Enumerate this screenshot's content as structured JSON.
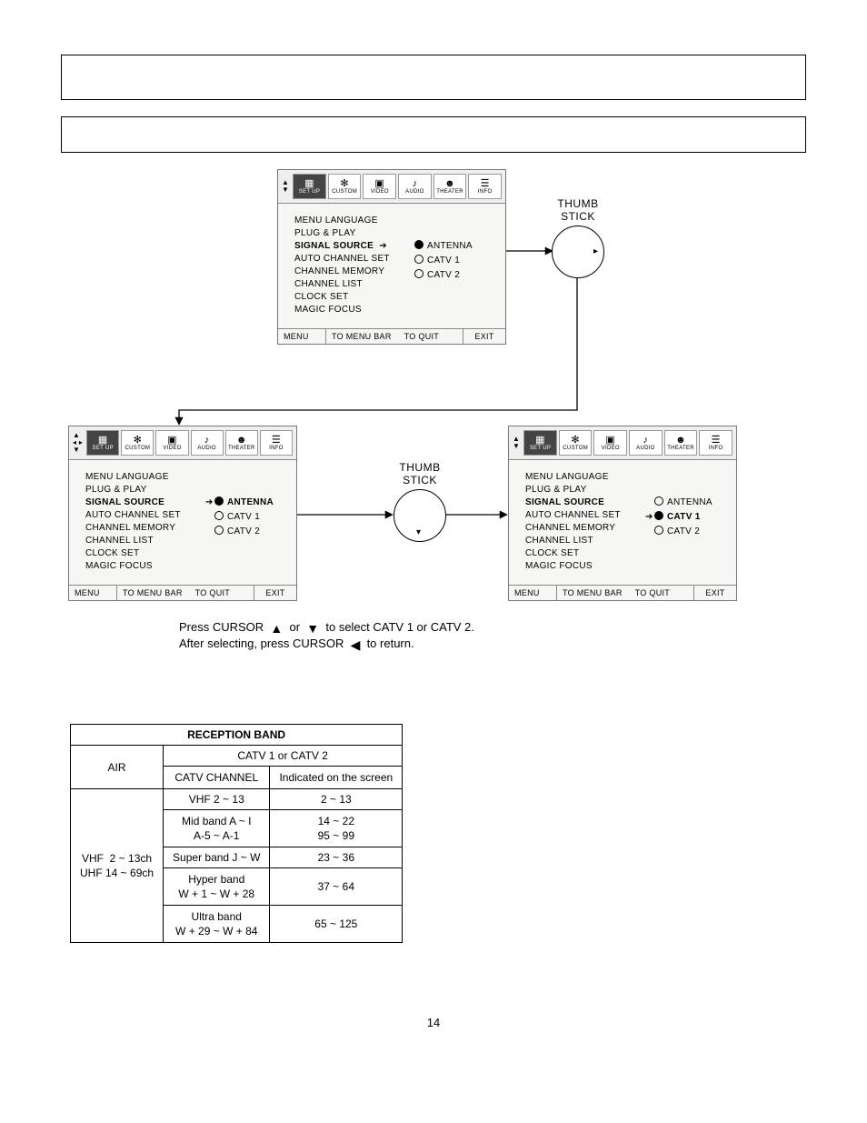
{
  "thumbstick_label": "THUMB\nSTICK",
  "osd": {
    "tabs": [
      "SET UP",
      "CUSTOM",
      "VIDEO",
      "AUDIO",
      "THEATER",
      "INFO"
    ],
    "items": [
      "MENU LANGUAGE",
      "PLUG & PLAY",
      "SIGNAL SOURCE",
      "AUTO CHANNEL SET",
      "CHANNEL MEMORY",
      "CHANNEL LIST",
      "CLOCK SET",
      "MAGIC FOCUS"
    ],
    "options": [
      "ANTENNA",
      "CATV 1",
      "CATV 2"
    ],
    "footer": {
      "menu": "MENU",
      "tobar": "TO MENU BAR",
      "quit": "TO QUIT",
      "exit": "EXIT"
    }
  },
  "legend": {
    "line1_pre": "Press CURSOR  ",
    "line1_mid": "  or  ",
    "line1_post": "  to select CATV 1 or CATV 2.",
    "line2_pre": "After selecting, press CURSOR  ",
    "line2_post": "  to return."
  },
  "table": {
    "title": "RECEPTION BAND",
    "air": "AIR",
    "catv_header": "CATV 1 or CATV 2",
    "ch_header": "CATV CHANNEL",
    "ind_header": "Indicated on the screen",
    "air_rows": "VHF  2 ~ 13ch\nUHF 14 ~ 69ch",
    "rows": [
      {
        "ch": "VHF 2 ~ 13",
        "ind": "2 ~ 13"
      },
      {
        "ch": "Mid band A ~ I\nA-5 ~ A-1",
        "ind": "14 ~ 22\n95 ~ 99"
      },
      {
        "ch": "Super band J ~ W",
        "ind": "23 ~ 36"
      },
      {
        "ch": "Hyper band\nW + 1 ~ W + 28",
        "ind": "37 ~ 64"
      },
      {
        "ch": "Ultra band\nW + 29 ~ W + 84",
        "ind": "65 ~ 125"
      }
    ]
  },
  "page_number": "14"
}
